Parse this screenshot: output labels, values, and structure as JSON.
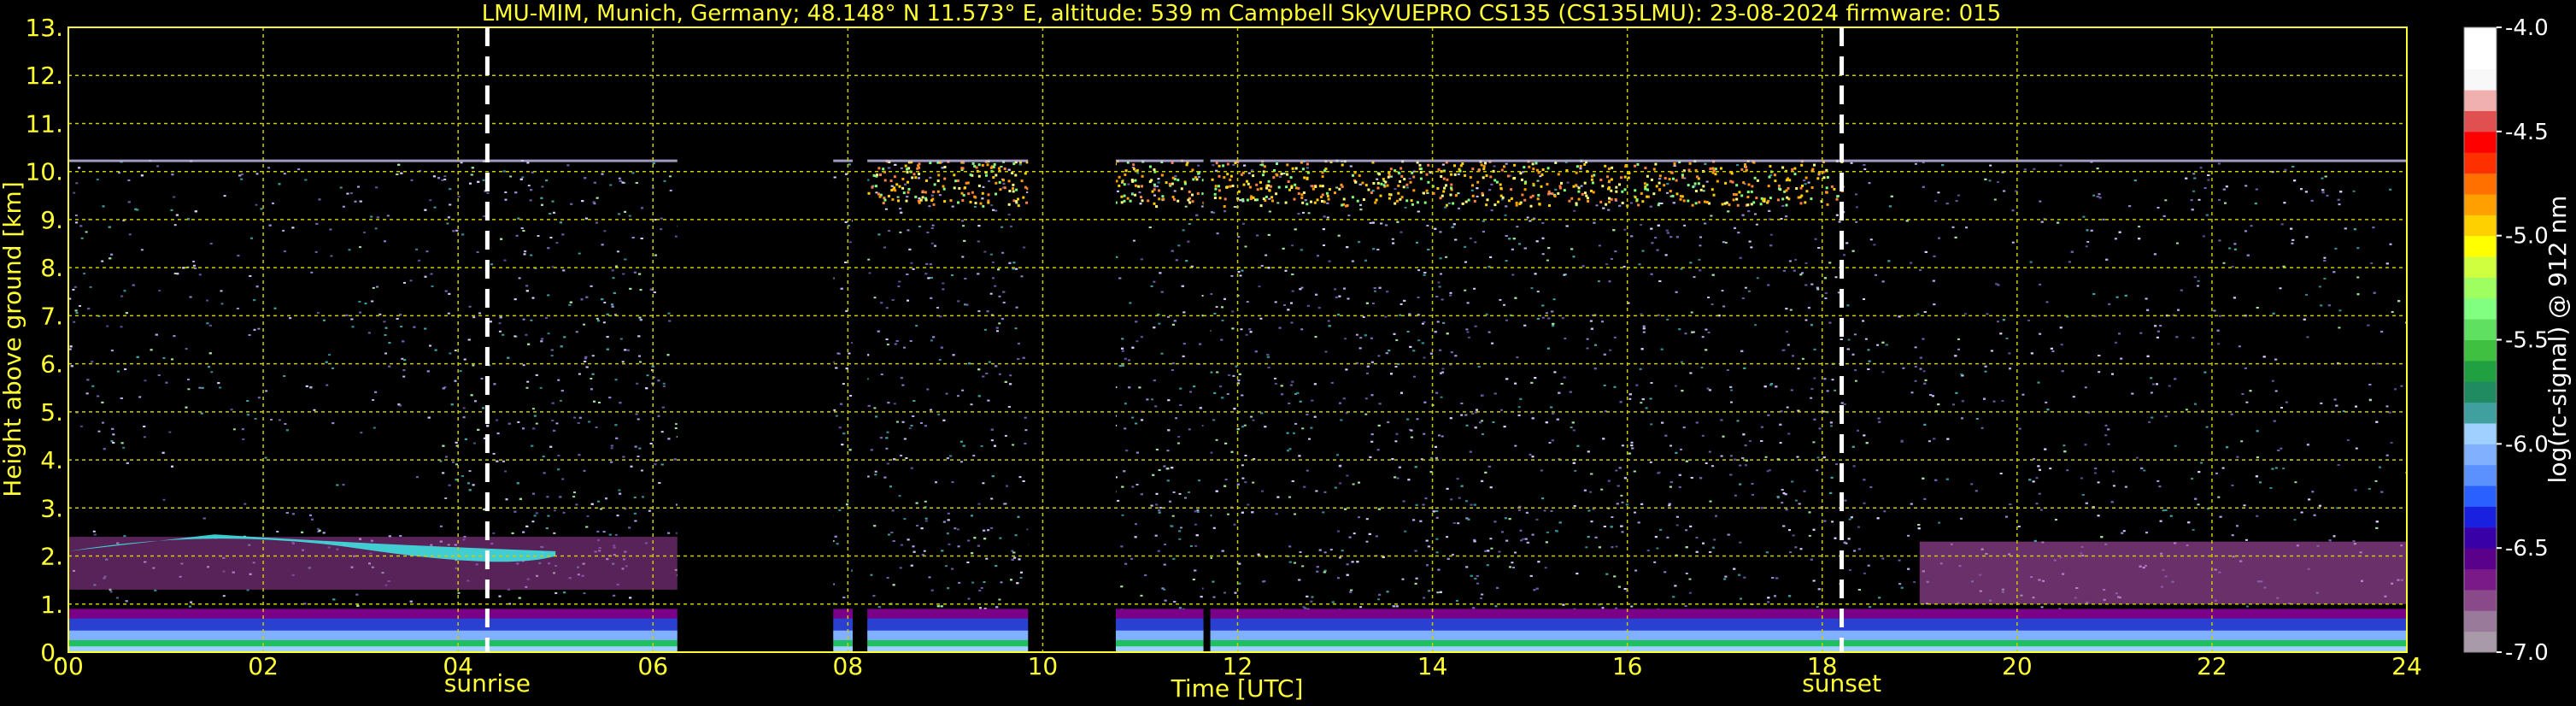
{
  "chart_data": {
    "type": "heatmap",
    "title": "LMU-MIM, Munich, Germany; 48.148° N 11.573° E, altitude: 539 m    Campbell SkyVUEPRO CS135 (CS135LMU): 23-08-2024    firmware: 015",
    "xlabel": "Time [UTC]",
    "ylabel": "Height above ground [km]",
    "xlim": [
      0,
      24
    ],
    "ylim": [
      0,
      13
    ],
    "x_ticks": [
      "00",
      "02",
      "04",
      "06",
      "08",
      "10",
      "12",
      "14",
      "16",
      "18",
      "20",
      "22",
      "24"
    ],
    "y_ticks": [
      "0.",
      "1.",
      "2.",
      "3.",
      "4.",
      "5.",
      "6.",
      "7.",
      "8.",
      "9.",
      "10.",
      "11.",
      "12.",
      "13."
    ],
    "grid": true,
    "markers": [
      {
        "label": "sunrise",
        "x": 4.3
      },
      {
        "label": "sunset",
        "x": 18.2
      }
    ],
    "data_gaps": [
      [
        6.25,
        7.85
      ],
      [
        8.05,
        8.2
      ],
      [
        9.85,
        10.75
      ],
      [
        11.65,
        11.72
      ]
    ],
    "signal_top_km": 10.25,
    "colorbar": {
      "label": "log(rc-signal) @ 912 nm",
      "range": [
        -7.0,
        -4.0
      ],
      "ticks": [
        "-7.0",
        "-6.5",
        "-6.0",
        "-5.5",
        "-5.0",
        "-4.5",
        "-4.0"
      ],
      "colors": [
        "#a89aa8",
        "#9a7a9a",
        "#8a4a8a",
        "#7a1a88",
        "#5a008a",
        "#3a00a8",
        "#1a20e0",
        "#2a60ff",
        "#5a90ff",
        "#80b0ff",
        "#a0d0ff",
        "#40a0a0",
        "#208a60",
        "#20a040",
        "#40c040",
        "#60e060",
        "#80ff80",
        "#a0ff60",
        "#d0ff40",
        "#ffff00",
        "#ffd000",
        "#ffa000",
        "#ff7000",
        "#ff3000",
        "#ff0000",
        "#e05050",
        "#f0b0b0",
        "#f8f8f8",
        "#ffffff",
        "#ffffff"
      ]
    }
  }
}
